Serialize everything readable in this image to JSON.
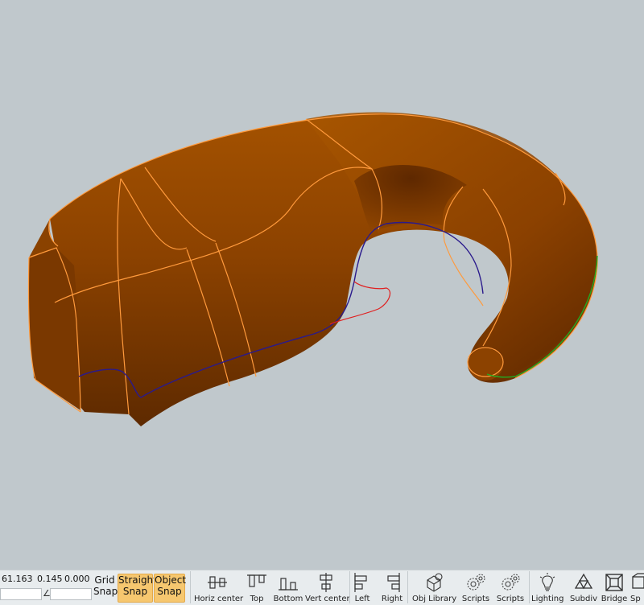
{
  "coords": {
    "x": "61.163",
    "y": "0.145",
    "z": "0.000"
  },
  "snaps": [
    {
      "line1": "Grid",
      "line2": "Snap",
      "active": false
    },
    {
      "line1": "Straight",
      "line2": "Snap",
      "active": true
    },
    {
      "line1": "Object",
      "line2": "Snap",
      "active": true
    }
  ],
  "toolbar": [
    {
      "label": "Horiz center",
      "icon": "horiz-center-icon"
    },
    {
      "label": "Top",
      "icon": "align-top-icon"
    },
    {
      "label": "Bottom",
      "icon": "align-bottom-icon"
    },
    {
      "label": "Vert center",
      "icon": "vert-center-icon"
    },
    {
      "label": "Left",
      "icon": "align-left-icon"
    },
    {
      "label": "Right",
      "icon": "align-right-icon"
    },
    {
      "label": "Obj Library",
      "icon": "object-library-icon"
    },
    {
      "label": "Scripts",
      "icon": "scripts-gear-icon"
    },
    {
      "label": "Scripts",
      "icon": "scripts-gear-icon"
    },
    {
      "label": "Lighting",
      "icon": "lightbulb-icon"
    },
    {
      "label": "Subdiv",
      "icon": "subdiv-icon"
    },
    {
      "label": "Bridge",
      "icon": "bridge-icon"
    },
    {
      "label": "Sp",
      "icon": "cube-icon"
    }
  ],
  "colors": {
    "model": "#9a4900",
    "edges": "#ff9a3c",
    "selected_curve": "#2a1a8c",
    "red_curve": "#e02020",
    "green_edge": "#22aa22",
    "active_snap": "#f6c76f"
  }
}
